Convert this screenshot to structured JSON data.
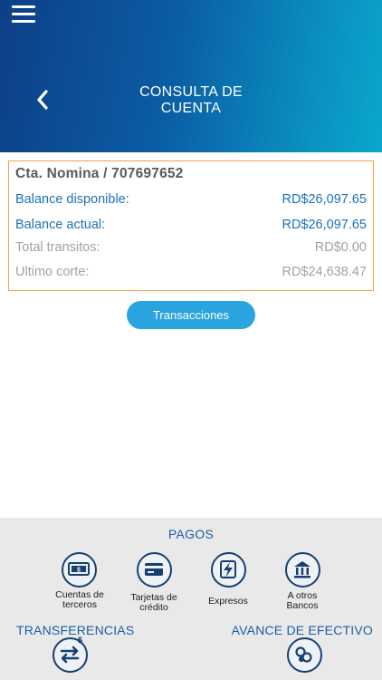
{
  "header": {
    "menu_icon": "hamburger-menu-icon",
    "back_icon": "chevron-left-icon",
    "title_line1": "CONSULTA DE",
    "title_line2": "CUENTA",
    "gradient_colors": [
      "#0d3f86",
      "#0aa7cc"
    ]
  },
  "account": {
    "title": "Cta. Nomina / 707697652",
    "rows": [
      {
        "label": "Balance disponible:",
        "value": "RD$26,097.65",
        "style": "blue"
      },
      {
        "label": "Balance actual:",
        "value": "RD$26,097.65",
        "style": "blue"
      },
      {
        "label": "Total transitos:",
        "value": "RD$0.00",
        "style": "gray"
      },
      {
        "label": "Ultimo corte:",
        "value": "RD$24,638.47",
        "style": "gray"
      }
    ],
    "border_color": "#f0a24a"
  },
  "actions": {
    "transacciones_label": "Transacciones",
    "button_color": "#2aa4df"
  },
  "pagos": {
    "title": "PAGOS",
    "items": [
      {
        "line1": "Cuentas de",
        "line2": "terceros",
        "icon": "cash-bill-icon"
      },
      {
        "line1": "Tarjetas de",
        "line2": "crédito",
        "icon": "credit-card-icon"
      },
      {
        "line1": "Expresos",
        "line2": "",
        "icon": "lightning-icon"
      },
      {
        "line1": "A otros",
        "line2": "Bancos",
        "icon": "bank-icon"
      }
    ]
  },
  "transferencias": {
    "title": "TRANSFERENCIAS",
    "icon": "transfer-arrows-icon"
  },
  "avance": {
    "title": "AVANCE DE EFECTIVO",
    "icon": "coins-icon"
  }
}
